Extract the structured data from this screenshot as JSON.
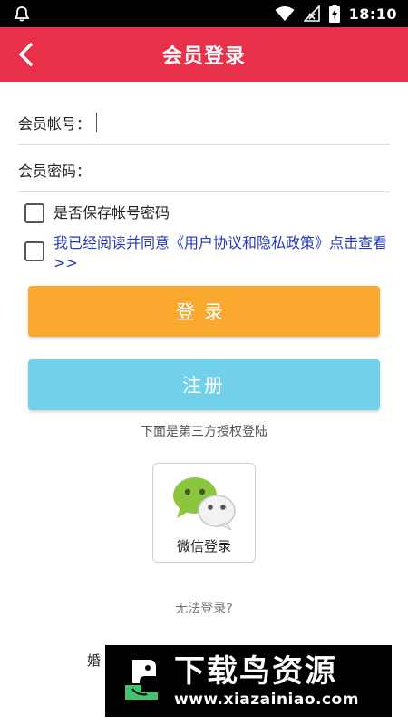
{
  "status_bar": {
    "time": "18:10",
    "icons": [
      "notification-icon",
      "wifi-icon",
      "signal-icon",
      "battery-icon"
    ]
  },
  "header": {
    "title": "会员登录",
    "back_icon": "chevron-left-icon",
    "color": "#e8304a"
  },
  "form": {
    "account_label": "会员帐号：",
    "account_value": "",
    "password_label": "会员密码：",
    "password_value": ""
  },
  "options": {
    "save_password_label": "是否保存帐号密码",
    "agreement_label": "我已经阅读并同意《用户协议和隐私政策》点击查看>>"
  },
  "buttons": {
    "login_label": "登录",
    "register_label": "注册"
  },
  "third_party": {
    "label": "下面是第三方授权登陆",
    "wechat_label": "微信登录"
  },
  "footer": {
    "cannot_login": "无法登录?",
    "partial_text": "婚"
  },
  "watermark": {
    "brand": "下载鸟资源",
    "url": "www.xiazainiao.com"
  }
}
